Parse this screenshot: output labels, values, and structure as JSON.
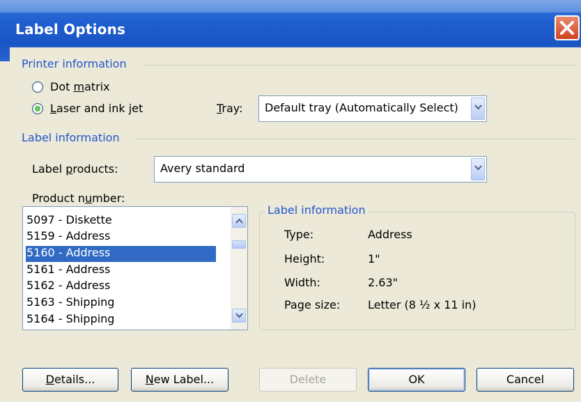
{
  "window": {
    "title": "Label Options"
  },
  "printer_info": {
    "header": "Printer information",
    "dot_matrix": {
      "prefix": "Dot ",
      "underline": "m",
      "suffix": "atrix",
      "selected": false
    },
    "laser": {
      "prefix": "",
      "underline": "L",
      "suffix": "aser and ink jet",
      "selected": true
    },
    "tray": {
      "prefix": "",
      "underline": "T",
      "suffix": "ray:",
      "value": "Default tray (Automatically Select)"
    }
  },
  "label_info": {
    "header": "Label information",
    "products": {
      "prefix": "Label ",
      "underline": "p",
      "suffix": "roducts:",
      "value": "Avery standard"
    },
    "product_number": {
      "prefix": "Product n",
      "underline": "u",
      "suffix": "mber:"
    },
    "items": [
      {
        "label": "5097 - Diskette",
        "selected": false
      },
      {
        "label": "5159 - Address",
        "selected": false
      },
      {
        "label": "5160 - Address",
        "selected": true
      },
      {
        "label": "5161 - Address",
        "selected": false
      },
      {
        "label": "5162 - Address",
        "selected": false
      },
      {
        "label": "5163 - Shipping",
        "selected": false
      },
      {
        "label": "5164 - Shipping",
        "selected": false
      }
    ]
  },
  "details_box": {
    "header": "Label information",
    "type_label": "Type:",
    "type_value": "Address",
    "height_label": "Height:",
    "height_value": "1\"",
    "width_label": "Width:",
    "width_value": "2.63\"",
    "page_label": "Page size:",
    "page_value": "Letter (8 ½ x 11 in)"
  },
  "buttons": {
    "details": {
      "underline": "D",
      "suffix": "etails..."
    },
    "new_label": {
      "underline": "N",
      "suffix": "ew Label..."
    },
    "delete": "Delete",
    "ok": "OK",
    "cancel": "Cancel"
  },
  "colors": {
    "accent": "#2255cc",
    "selection": "#316ac5",
    "titlebar": "#1f5fcf"
  },
  "icons": [
    "close-icon",
    "chevron-down-icon",
    "scroll-up-icon",
    "scroll-down-icon"
  ]
}
